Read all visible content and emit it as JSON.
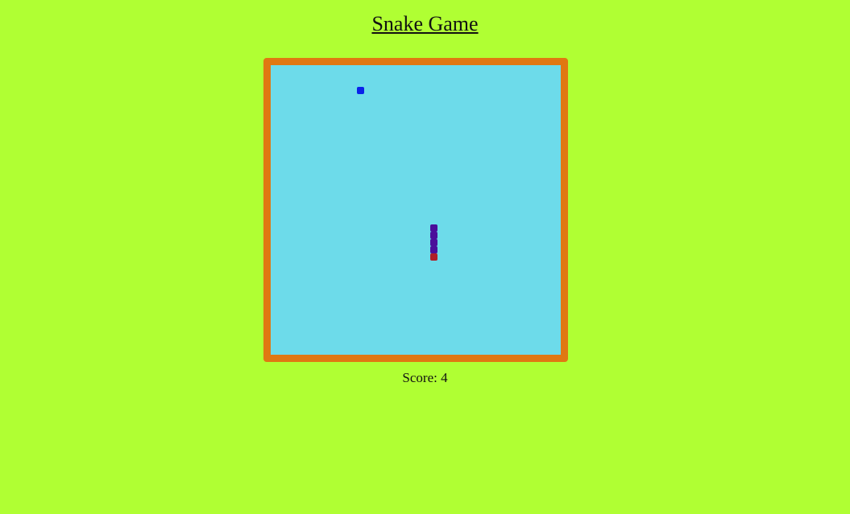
{
  "title": "Snake Game",
  "score": {
    "label": "Score: ",
    "value": "4"
  },
  "colors": {
    "background": "#b0ff33",
    "board_fill": "#6ddbea",
    "board_border": "#e07812",
    "snake_head": "#b01e28",
    "snake_body": "#4a0f9a",
    "food": "#0a22ea"
  },
  "game": {
    "food_present": true,
    "snake_segments": 5,
    "direction": "down"
  }
}
